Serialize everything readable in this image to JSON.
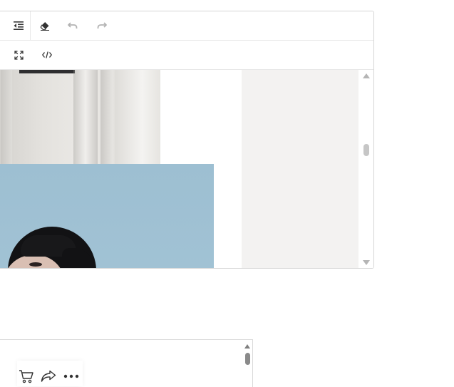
{
  "editor": {
    "toolbar_row1": [
      {
        "name": "outdent-icon"
      },
      {
        "name": "clear-format-icon"
      },
      {
        "name": "undo-icon"
      },
      {
        "name": "redo-icon"
      }
    ],
    "toolbar_row2": [
      {
        "name": "fullscreen-icon"
      },
      {
        "name": "source-code-icon"
      }
    ]
  },
  "colors": {
    "border": "#d6d6d6",
    "sidebar_panel": "#f3f2f1",
    "photo_blue": "#9dbfd2",
    "icon_dark": "#333333",
    "icon_disabled": "#b3b3b3"
  },
  "lower_panel": {
    "actions": [
      {
        "name": "cart-icon"
      },
      {
        "name": "share-icon"
      },
      {
        "name": "more-icon"
      }
    ]
  }
}
